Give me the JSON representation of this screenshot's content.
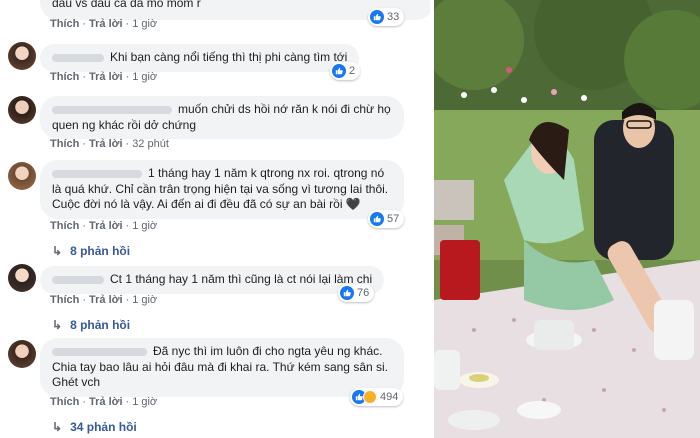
{
  "top_comment": {
    "text_fragment": "dau vs dau ca da mo mom r",
    "actions": {
      "like": "Thích",
      "reply": "Trả lời",
      "time": "1 giờ"
    },
    "reaction_count": "33"
  },
  "comments": [
    {
      "text": "Khi bạn càng nổi tiếng thì thị phi càng tìm tới",
      "actions": {
        "like": "Thích",
        "reply": "Trả lời",
        "time": "1 giờ"
      },
      "reaction_count": "2"
    },
    {
      "text": "muốn chửi ds hồi nớ răn k nói đi chừ họ quen ng khác rồi dở chứng",
      "actions": {
        "like": "Thích",
        "reply": "Trả lời",
        "time": "32 phút"
      }
    },
    {
      "text": "1 tháng hay 1 năm k qtrong nx roi. qtrong nó là quá khứ. Chỉ cần trân trọng hiện tại va sống vì tương lai thôi. Cuộc đời nó là vậy. Ai đến ai đi đều đã có sự an bài rồi 🖤",
      "actions": {
        "like": "Thích",
        "reply": "Trả lời",
        "time": "1 giờ"
      },
      "reaction_count": "57",
      "replies_label": "8 phản hồi"
    },
    {
      "text": "Ct 1 tháng hay 1 năm thì cũng là ct nói lại làm chi",
      "actions": {
        "like": "Thích",
        "reply": "Trả lời",
        "time": "1 giờ"
      },
      "reaction_count": "76",
      "replies_label": "8 phản hồi"
    },
    {
      "text": "Đã nyc thì im luôn đi cho ngta yêu ng khác. Chia tay bao lâu ai hỏi đâu mà đi khai ra. Thứ kém sang sân si. Ghét vch",
      "actions": {
        "like": "Thích",
        "reply": "Trả lời",
        "time": "1 giờ"
      },
      "reaction_count": "494",
      "replies_label": "34 phản hồi"
    }
  ],
  "colors": {
    "bubble": "#f2f3f5",
    "link": "#385898",
    "like": "#1877f2",
    "haha": "#f7b125"
  },
  "icons": {
    "like": "thumbs-up-icon",
    "haha": "haha-emoji-icon",
    "replies": "reply-arrow-icon"
  }
}
